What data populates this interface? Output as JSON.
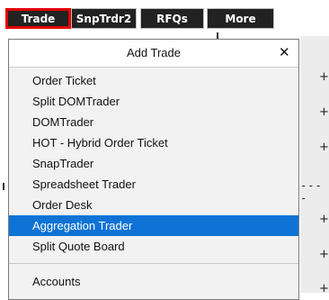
{
  "tabs": [
    {
      "label": "Trade"
    },
    {
      "label": "SnpTrdr2"
    },
    {
      "label": "RFQs"
    },
    {
      "label": "More"
    }
  ],
  "menu": {
    "title": "Add Trade",
    "close_glyph": "✕",
    "items": [
      {
        "label": "Order Ticket"
      },
      {
        "label": "Split DOMTrader"
      },
      {
        "label": "DOMTrader"
      },
      {
        "label": "HOT - Hybrid Order Ticket"
      },
      {
        "label": "SnapTrader"
      },
      {
        "label": "Spreadsheet Trader"
      },
      {
        "label": "Order Desk"
      },
      {
        "label": "Aggregation Trader"
      },
      {
        "label": "Split Quote Board"
      },
      {
        "label": "Accounts"
      }
    ],
    "selected_item": "Aggregation Trader"
  },
  "background": {
    "plus_glyph": "+",
    "dash_text": "----"
  },
  "colors": {
    "tab_bg": "#222222",
    "highlight_border": "#e30000",
    "selected_bg": "#0f73d6"
  }
}
